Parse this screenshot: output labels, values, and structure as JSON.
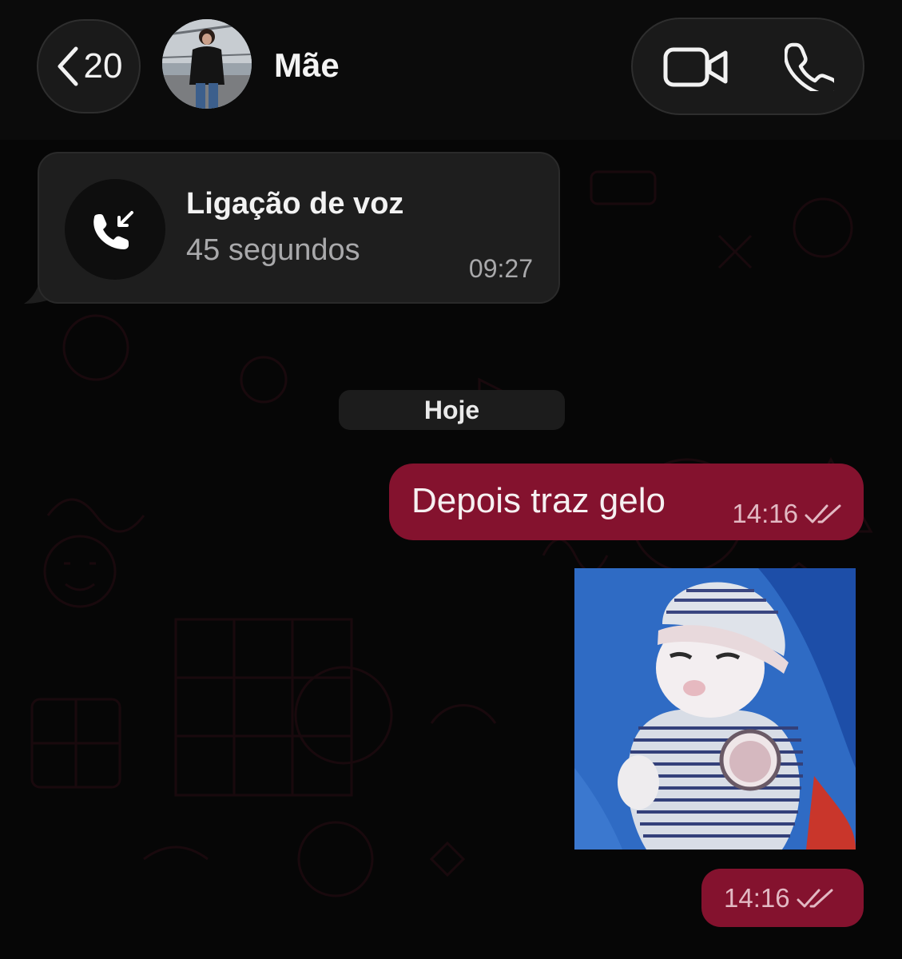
{
  "header": {
    "back_count": "20",
    "contact_name": "Mãe"
  },
  "icons": {
    "back": "chevron-left-icon",
    "video": "video-camera-icon",
    "phone": "phone-icon",
    "incoming_call": "incoming-call-icon",
    "read_ticks": "double-check-icon"
  },
  "call_log": {
    "title": "Ligação de voz",
    "duration": "45 segundos",
    "time": "09:27"
  },
  "date_separator": "Hoje",
  "messages": [
    {
      "text": "Depois traz gelo",
      "time": "14:16",
      "status": "read"
    },
    {
      "type": "image",
      "time": "14:16",
      "status": "read"
    }
  ],
  "colors": {
    "outgoing_bubble": "#84122e",
    "incoming_bubble": "#1e1e1e",
    "background": "#060606"
  }
}
